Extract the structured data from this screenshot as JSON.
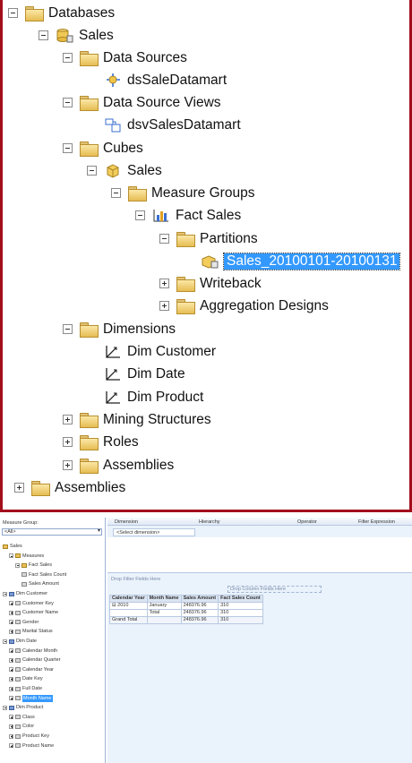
{
  "tree": {
    "databases": "Databases",
    "sales_db": "Sales",
    "data_sources": "Data Sources",
    "ds": "dsSaleDatamart",
    "dsv_folder": "Data Source Views",
    "dsv": "dsvSalesDatamart",
    "cubes": "Cubes",
    "cube_sales": "Sales",
    "measure_groups": "Measure Groups",
    "fact_sales": "Fact Sales",
    "partitions": "Partitions",
    "partition": "Sales_20100101-20100131",
    "writeback": "Writeback",
    "aggregation_designs": "Aggregation Designs",
    "dimensions": "Dimensions",
    "dim_customer": "Dim Customer",
    "dim_date": "Dim Date",
    "dim_product": "Dim Product",
    "mining_structures": "Mining Structures",
    "roles": "Roles",
    "assemblies_inner": "Assemblies",
    "assemblies_outer": "Assemblies"
  },
  "metadata": {
    "measure_group_label": "Measure Group:",
    "measure_group_value": "<All>",
    "items": [
      {
        "label": "Sales",
        "level": 0,
        "icon": "gold",
        "exp": "none"
      },
      {
        "label": "Measures",
        "level": 1,
        "icon": "gold",
        "exp": "minus"
      },
      {
        "label": "Fact Sales",
        "level": 2,
        "icon": "gold",
        "exp": "minus"
      },
      {
        "label": "Fact Sales Count",
        "level": 3,
        "icon": "attr",
        "exp": "none"
      },
      {
        "label": "Sales Amount",
        "level": 3,
        "icon": "attr",
        "exp": "none"
      },
      {
        "label": "Dim Customer",
        "level": 0,
        "icon": "dim",
        "exp": "minus"
      },
      {
        "label": "Customer Key",
        "level": 1,
        "icon": "attr",
        "exp": "plus"
      },
      {
        "label": "Customer Name",
        "level": 1,
        "icon": "attr",
        "exp": "plus"
      },
      {
        "label": "Gender",
        "level": 1,
        "icon": "attr",
        "exp": "plus"
      },
      {
        "label": "Marital Status",
        "level": 1,
        "icon": "attr",
        "exp": "plus"
      },
      {
        "label": "Dim Date",
        "level": 0,
        "icon": "dim",
        "exp": "minus"
      },
      {
        "label": "Calendar Month",
        "level": 1,
        "icon": "attr",
        "exp": "plus"
      },
      {
        "label": "Calendar Quarter",
        "level": 1,
        "icon": "attr",
        "exp": "plus"
      },
      {
        "label": "Calendar Year",
        "level": 1,
        "icon": "attr",
        "exp": "plus"
      },
      {
        "label": "Date Key",
        "level": 1,
        "icon": "attr",
        "exp": "plus"
      },
      {
        "label": "Full Date",
        "level": 1,
        "icon": "attr",
        "exp": "plus"
      },
      {
        "label": "Month Name",
        "level": 1,
        "icon": "attr",
        "exp": "plus",
        "selected": true
      },
      {
        "label": "Dim Product",
        "level": 0,
        "icon": "dim",
        "exp": "minus"
      },
      {
        "label": "Class",
        "level": 1,
        "icon": "attr",
        "exp": "plus"
      },
      {
        "label": "Color",
        "level": 1,
        "icon": "attr",
        "exp": "plus"
      },
      {
        "label": "Product Key",
        "level": 1,
        "icon": "attr",
        "exp": "plus"
      },
      {
        "label": "Product Name",
        "level": 1,
        "icon": "attr",
        "exp": "plus"
      }
    ]
  },
  "filter": {
    "headers": [
      "Dimension",
      "Hierarchy",
      "Operator",
      "Filter Expression"
    ],
    "select_dimension": "<Select dimension>"
  },
  "pivot": {
    "drop_filter": "Drop Filter Fields Here",
    "drop_column": "Drop Column Fields Here",
    "headers": [
      "Calendar Year",
      "Month Name",
      "Sales Amount",
      "Fact Sales Count"
    ],
    "rows": [
      [
        "⊟ 2010",
        "January",
        "248376.96",
        "310"
      ],
      [
        "",
        "Total",
        "248376.96",
        "310"
      ],
      [
        "Grand Total",
        "",
        "248376.96",
        "310"
      ]
    ]
  },
  "colors": {
    "frame": "#a30e1c",
    "selection": "#3399ff"
  }
}
